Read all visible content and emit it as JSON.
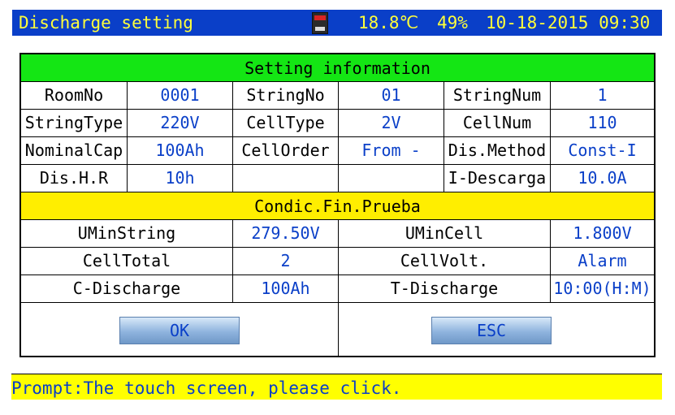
{
  "titlebar": {
    "title": "Discharge setting",
    "temperature": "18.8℃",
    "battery": "49%",
    "datetime": "10-18-2015 09:30",
    "storage_icon": "sd-card-icon"
  },
  "setting": {
    "header": "Setting information",
    "room_label": "RoomNo",
    "room_value": "0001",
    "string_no_label": "StringNo",
    "string_no_value": "01",
    "string_num_label": "StringNum",
    "string_num_value": "1",
    "string_type_label": "StringType",
    "string_type_value": "220V",
    "cell_type_label": "CellType",
    "cell_type_value": "2V",
    "cell_num_label": "CellNum",
    "cell_num_value": "110",
    "nominal_cap_label": "NominalCap",
    "nominal_cap_value": "100Ah",
    "cell_order_label": "CellOrder",
    "cell_order_value": "From -",
    "dis_method_label": "Dis.Method",
    "dis_method_value": "Const-I",
    "dis_hr_label": "Dis.H.R",
    "dis_hr_value": "10h",
    "i_descarga_label": "I-Descarga",
    "i_descarga_value": "10.0A"
  },
  "end_condition": {
    "header": "Condic.Fin.Prueba",
    "umin_string_label": "UMinString",
    "umin_string_value": "279.50V",
    "umin_cell_label": "UMinCell",
    "umin_cell_value": "1.800V",
    "cell_total_label": "CellTotal",
    "cell_total_value": "2",
    "cell_volt_label": "CellVolt.",
    "cell_volt_value": "Alarm",
    "c_discharge_label": "C-Discharge",
    "c_discharge_value": "100Ah",
    "t_discharge_label": "T-Discharge",
    "t_discharge_value": "10:00(H:M)"
  },
  "buttons": {
    "ok": "OK",
    "esc": "ESC"
  },
  "prompt": "Prompt:The touch screen, please click.",
  "colors": {
    "title_bg": "#0a3fc8",
    "title_text": "#ffff3a",
    "section_green": "#14e614",
    "section_yellow": "#ffee00",
    "value_text": "#0a3fc8",
    "prompt_bg": "#ffff00"
  }
}
